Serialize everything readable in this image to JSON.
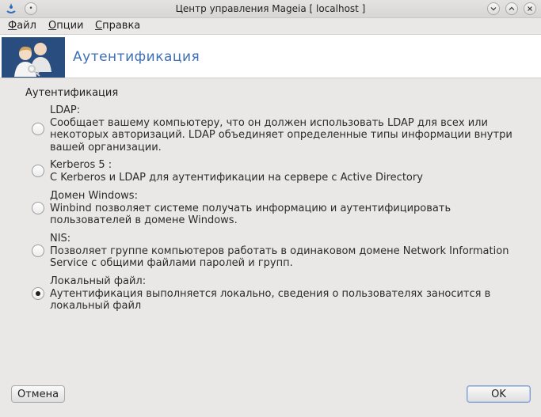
{
  "window": {
    "title": "Центр управления Mageia  [ localhost ]"
  },
  "menu": {
    "items": [
      {
        "label_first": "Ф",
        "label_rest": "айл"
      },
      {
        "label_first": "О",
        "label_rest": "пции"
      },
      {
        "label_first": "С",
        "label_rest": "правка"
      }
    ]
  },
  "banner": {
    "title": "Аутентификация",
    "icon": "users-icon"
  },
  "section": {
    "title": "Аутентификация"
  },
  "options": [
    {
      "name": "LDAP:",
      "description": "Сообщает вашему компьютеру, что он должен использовать LDAP для всех или некоторых авторизаций. LDAP объединяет определенные типы информации внутри вашей организации.",
      "checked": false
    },
    {
      "name": "Kerberos 5 :",
      "description": "С Kerberos и LDAP для аутентификации на сервере с Active Directory",
      "checked": false
    },
    {
      "name": "Домен Windows:",
      "description": "Winbind позволяет системе получать информацию и аутентифицировать пользователей в домене Windows.",
      "checked": false
    },
    {
      "name": "NIS:",
      "description": "Позволяет группе компьютеров работать в одинаковом домене Network Information Service с общими файлами паролей и групп.",
      "checked": false
    },
    {
      "name": "Локальный файл:",
      "description": "Аутентификация выполняется локально, сведения о пользователях заносится в локальный файл",
      "checked": true
    }
  ],
  "buttons": {
    "cancel": "Отмена",
    "ok": "OK"
  },
  "colors": {
    "accent": "#3d6fb6",
    "background": "#e9e8e6"
  }
}
